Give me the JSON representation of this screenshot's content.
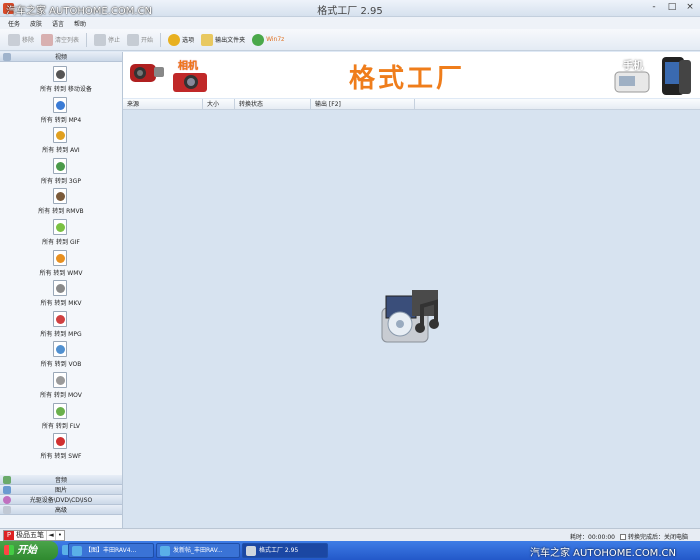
{
  "watermark_top": "汽车之家  AUTOHOME.COM.CN",
  "window_title": "格式工厂  2.95",
  "window_controls": [
    "-",
    "□",
    "×"
  ],
  "menu": [
    "任务",
    "皮肤",
    "语言",
    "帮助"
  ],
  "toolbar": [
    {
      "label": "移除",
      "enabled": false
    },
    {
      "label": "清空列表",
      "enabled": false
    },
    {
      "label": "停止",
      "enabled": false
    },
    {
      "label": "开始",
      "enabled": false
    },
    {
      "label": "选项",
      "enabled": true
    },
    {
      "label": "输出文件夹",
      "enabled": true
    },
    {
      "label": "Win7z",
      "enabled": true
    }
  ],
  "sidebar": {
    "video_header": "视频",
    "video_items": [
      {
        "label": "所有 转到 移动设备",
        "color": "#555555"
      },
      {
        "label": "所有 转到 MP4",
        "color": "#3a7bd5"
      },
      {
        "label": "所有 转到 AVI",
        "color": "#e0a020"
      },
      {
        "label": "所有 转到 3GP",
        "color": "#4a9a4a"
      },
      {
        "label": "所有 转到 RMVB",
        "color": "#7a5a3a"
      },
      {
        "label": "所有 转到 GIF",
        "color": "#7ac143"
      },
      {
        "label": "所有 转到 WMV",
        "color": "#e89020"
      },
      {
        "label": "所有 转到 MKV",
        "color": "#8a8a8a"
      },
      {
        "label": "所有 转到 MPG",
        "color": "#d04040"
      },
      {
        "label": "所有 转到 VOB",
        "color": "#5090d0"
      },
      {
        "label": "所有 转到 MOV",
        "color": "#9a9a9a"
      },
      {
        "label": "所有 转到 FLV",
        "color": "#6ab04c"
      },
      {
        "label": "所有 转到 SWF",
        "color": "#d03030"
      }
    ],
    "categories": [
      "音频",
      "图片",
      "光驱设备\\DVD\\CD\\ISO",
      "高级"
    ]
  },
  "banner": {
    "camera_label": "相机",
    "logo_text": "格式工厂",
    "phone_label": "手机"
  },
  "table_columns": [
    "来源",
    "大小",
    "转换状态",
    "输出 [F2]"
  ],
  "status": {
    "ime_tag": "P",
    "ime_name": "极品五笔",
    "ime_symbols": [
      "◄",
      "•"
    ],
    "elapsed": "耗时：00:00:00",
    "after_complete": "转换完成后：关闭电脑"
  },
  "taskbar": {
    "start_label": "开始",
    "tasks": [
      "【图】丰田RAV4...",
      "发新帖_丰田RAV...",
      "格式工厂 2.95"
    ],
    "watermark": "汽车之家  AUTOHOME.COM.CN"
  },
  "colors": {
    "accent_orange": "#ef7d1b",
    "sidebar_bg": "#eef3f9",
    "content_bg": "#d7e3f0",
    "taskbar_blue": "#2358c9"
  }
}
